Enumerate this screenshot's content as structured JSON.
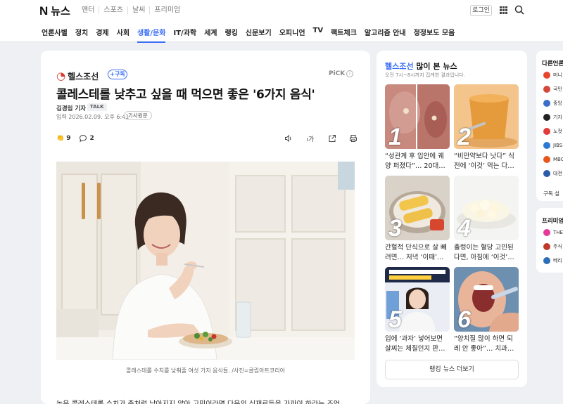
{
  "topbar": {
    "logo_n": "N",
    "logo_text": "뉴스",
    "links": [
      "엔터",
      "스포츠",
      "날씨",
      "프리미엄"
    ],
    "login": "로그인"
  },
  "nav": {
    "items": [
      "언론사별",
      "정치",
      "경제",
      "사회",
      "생활/문화",
      "IT/과학",
      "세계",
      "랭킹",
      "신문보기",
      "오피니언",
      "TV",
      "팩트체크",
      "알고리즘 안내",
      "정정보도 모음"
    ],
    "active_index": 4,
    "accent": "#3b6ef5"
  },
  "article": {
    "press_name": "헬스조선",
    "subscribe": "+구독",
    "pick": "PiCK",
    "title": "콜레스테롤 낮추고 싶을 때 먹으면 좋은 '6가지 음식'",
    "reporter": "김경림 기자",
    "talk": "TALK",
    "date_label": "입력",
    "date": "2026.02.09. 오후 6:41",
    "original_link": "기사원문",
    "reaction_count": "9",
    "comment_count": "2",
    "font_size_label": "가",
    "caption": "콜레스테롤 수치를 낮춰줄 여섯 가지 음식들. /사진=클립아트코리아",
    "body_first_line": "높은 콜레스테롤 수치가 좀처럼 낮아지지 않아 고민이라면 다음의 식재료들을 가까이 하라는 조언"
  },
  "ranking": {
    "press": "헬스조선",
    "title_rest": " 많이 본 뉴스",
    "subtitle": "오전 7시~8시까지 집계한 결과입니다.",
    "items": [
      {
        "num": "1",
        "text": "“성관계 후 입안에 궤양 퍼졌다”… 20대…"
      },
      {
        "num": "2",
        "text": "“비만약보다 낫다” 식전에 ‘이것’ 먹는 다…"
      },
      {
        "num": "3",
        "text": "간헐적 단식으로 살 빼려면… 저녁 ‘이때’…"
      },
      {
        "num": "4",
        "text": "출렁이는 혈당 고민된다면, 아침에 ‘이것’…"
      },
      {
        "num": "5",
        "text": "입에 ‘과자’ 넣어보면 살찌는 체질인지 판…"
      },
      {
        "num": "6",
        "text": "“양치질 많이 하면 되레 안 좋아”… 치과…"
      }
    ],
    "more": "랭킹 뉴스 더보기"
  },
  "side": {
    "title": "다른언론사",
    "items": [
      "머니",
      "국민",
      "중앙",
      "기자",
      "노컷",
      "JIBS",
      "MBC",
      "대전"
    ],
    "colors": [
      "#e8452f",
      "#d34a3a",
      "#3a6ec8",
      "#222222",
      "#e03c3c",
      "#2b7bd3",
      "#e9561b",
      "#2a5ca8"
    ],
    "subscribe_label": "구독 설",
    "title2": "프리미엄",
    "items2": [
      "THE",
      "주식",
      "베리"
    ],
    "colors2": [
      "#e6399b",
      "#c0392b",
      "#2d6fb7"
    ]
  }
}
